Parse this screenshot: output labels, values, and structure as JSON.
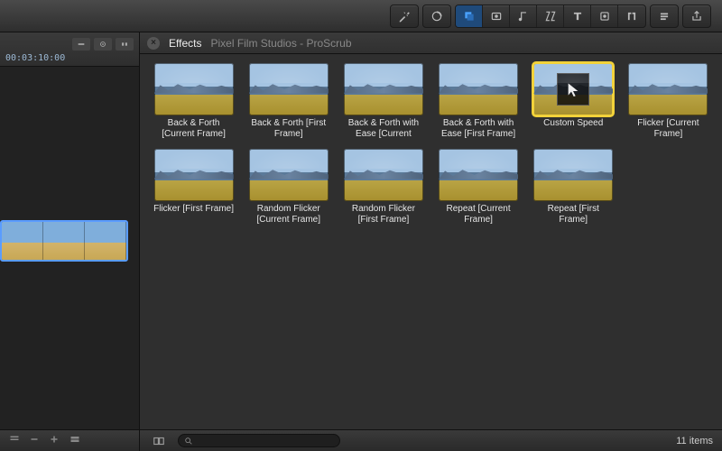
{
  "timeline": {
    "timecode": "00:03:10:00"
  },
  "header": {
    "tab_label": "Effects",
    "breadcrumb": "Pixel Film Studios - ProScrub"
  },
  "effects": [
    {
      "label": "Back & Forth [Current Frame]",
      "selected": false,
      "overlay": false
    },
    {
      "label": "Back & Forth [First Frame]",
      "selected": false,
      "overlay": false
    },
    {
      "label": "Back & Forth with Ease [Current",
      "selected": false,
      "overlay": false
    },
    {
      "label": "Back & Forth with Ease [First Frame]",
      "selected": false,
      "overlay": false
    },
    {
      "label": "Custom Speed",
      "selected": true,
      "overlay": true
    },
    {
      "label": "Flicker [Current Frame]",
      "selected": false,
      "overlay": false
    },
    {
      "label": "Flicker [First Frame]",
      "selected": false,
      "overlay": false
    },
    {
      "label": "Random Flicker [Current Frame]",
      "selected": false,
      "overlay": false
    },
    {
      "label": "Random Flicker [First Frame]",
      "selected": false,
      "overlay": false
    },
    {
      "label": "Repeat [Current Frame]",
      "selected": false,
      "overlay": false
    },
    {
      "label": "Repeat [First Frame]",
      "selected": false,
      "overlay": false
    }
  ],
  "footer": {
    "search_placeholder": "",
    "item_count": "11 items"
  }
}
